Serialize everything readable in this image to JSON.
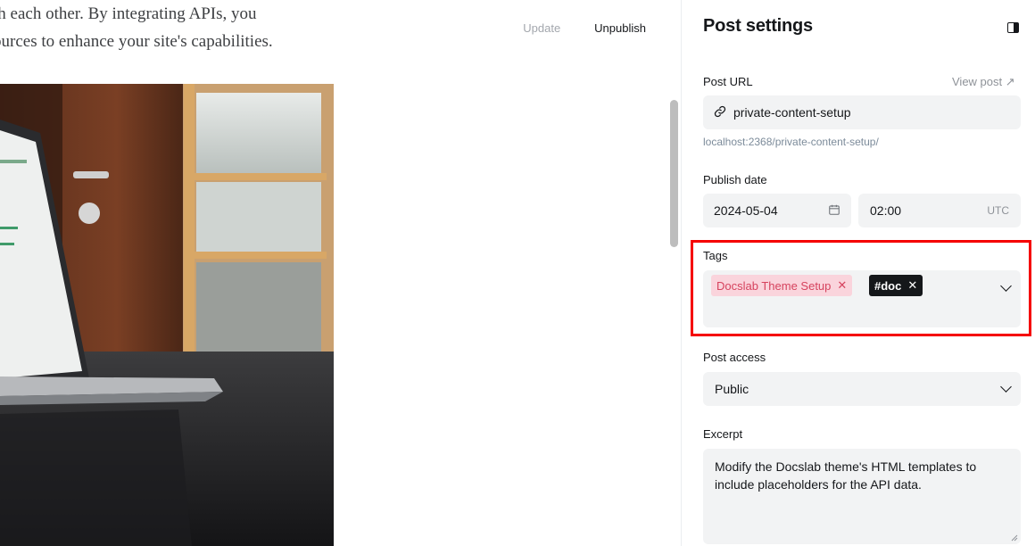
{
  "editor": {
    "body_lines": [
      "th each other. By integrating APIs, you",
      "ources to enhance your site's capabilities."
    ],
    "update_label": "Update",
    "unpublish_label": "Unpublish"
  },
  "settings": {
    "title": "Post settings",
    "post_url": {
      "label": "Post URL",
      "view_post_label": "View post ↗",
      "value": "private-content-setup",
      "hint": "localhost:2368/private-content-setup/"
    },
    "publish_date": {
      "label": "Publish date",
      "date": "2024-05-04",
      "time": "02:00",
      "timezone": "UTC"
    },
    "tags": {
      "label": "Tags",
      "items": [
        {
          "name": "Docslab Theme Setup",
          "color": "#d6435e"
        },
        {
          "name": "#doc",
          "color": "#15171a"
        }
      ]
    },
    "post_access": {
      "label": "Post access",
      "value": "Public"
    },
    "excerpt": {
      "label": "Excerpt",
      "value": "Modify the Docslab theme's HTML templates to include placeholders for the API data."
    }
  },
  "colors": {
    "highlight": "#f50000",
    "field_bg": "#f2f3f4",
    "tag_pink_bg": "#fad4dc"
  }
}
